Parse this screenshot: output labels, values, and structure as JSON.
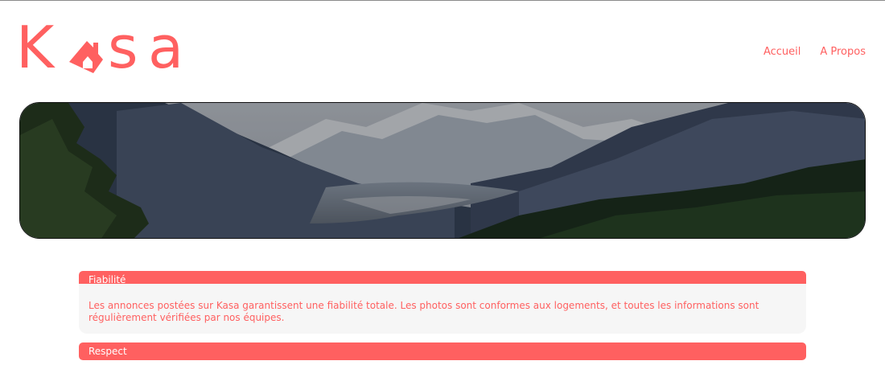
{
  "logo": {
    "letters": [
      "K",
      "s",
      "a"
    ],
    "brand_color": "#FF6060"
  },
  "nav": {
    "items": [
      "Accueil",
      "A Propos"
    ]
  },
  "banner": {
    "image": "mountain-valley-landscape"
  },
  "collapses": [
    {
      "title": "Fiabilité",
      "text": "Les annonces postées sur Kasa garantissent une fiabilité totale. Les photos sont conformes aux logements, et toutes les informations sont régulièrement vérifiées par nos équipes."
    },
    {
      "title": "Respect"
    }
  ]
}
